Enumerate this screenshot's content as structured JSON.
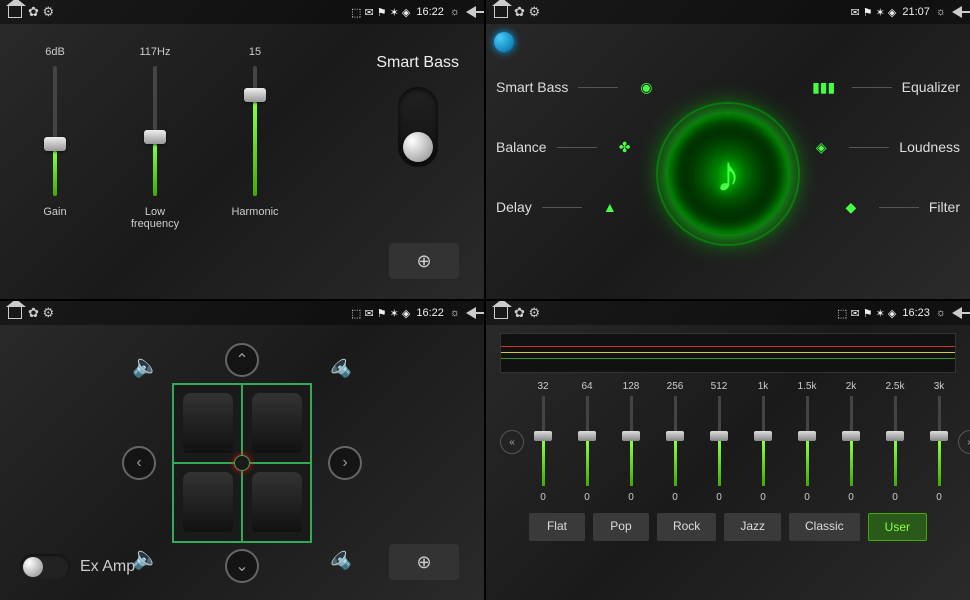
{
  "statusbars": [
    {
      "time": "16:22"
    },
    {
      "time": "21:07"
    },
    {
      "time": "16:22"
    },
    {
      "time": "16:23"
    }
  ],
  "smartbass": {
    "title": "Smart Bass",
    "sliders": [
      {
        "value": "6dB",
        "label": "Gain",
        "pct": 35
      },
      {
        "value": "117Hz",
        "label": "Low frequency",
        "pct": 40
      },
      {
        "value": "15",
        "label": "Harmonic",
        "pct": 72
      }
    ],
    "toggle_on": true
  },
  "audiomenu": {
    "left": [
      {
        "label": "Smart Bass"
      },
      {
        "label": "Balance"
      },
      {
        "label": "Delay"
      }
    ],
    "right": [
      {
        "label": "Equalizer"
      },
      {
        "label": "Loudness"
      },
      {
        "label": "Filter"
      }
    ]
  },
  "balance": {
    "examp_label": "Ex Amp",
    "examp_on": false
  },
  "eq": {
    "freqs": [
      "32",
      "64",
      "128",
      "256",
      "512",
      "1k",
      "1.5k",
      "2k",
      "2.5k",
      "3k"
    ],
    "values": [
      "0",
      "0",
      "0",
      "0",
      "0",
      "0",
      "0",
      "0",
      "0",
      "0"
    ],
    "pcts": [
      50,
      50,
      50,
      50,
      50,
      50,
      50,
      50,
      50,
      50
    ],
    "presets": [
      "Flat",
      "Pop",
      "Rock",
      "Jazz",
      "Classic",
      "User"
    ],
    "active_preset": "User"
  },
  "colors": {
    "accent": "#44cc00",
    "bg": "#1a1a1a"
  }
}
